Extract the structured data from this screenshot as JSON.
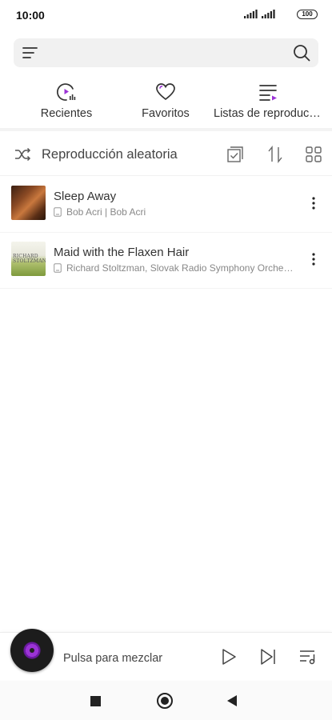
{
  "status_bar": {
    "time": "10:00",
    "battery": "100"
  },
  "search": {
    "placeholder": ""
  },
  "quick_tabs": [
    {
      "label": "Recientes",
      "icon": "recent-icon"
    },
    {
      "label": "Favoritos",
      "icon": "heart-icon"
    },
    {
      "label": "Listas de reproducción",
      "icon": "playlist-icon"
    }
  ],
  "shuffle": {
    "label": "Reproducción aleatoria"
  },
  "songs": [
    {
      "title": "Sleep Away",
      "subtitle": "Bob Acri | Bob Acri",
      "cover_text": ""
    },
    {
      "title": "Maid with the Flaxen Hair",
      "subtitle": "Richard Stoltzman, Slovak Radio Symphony Orchestra",
      "cover_text": "RICHARD STOLTZMAN"
    }
  ],
  "player": {
    "label": "Pulsa para mezclar"
  },
  "colors": {
    "accent": "#9b33d6",
    "background": "#ffffff",
    "search_bg": "#f1f1f1"
  }
}
